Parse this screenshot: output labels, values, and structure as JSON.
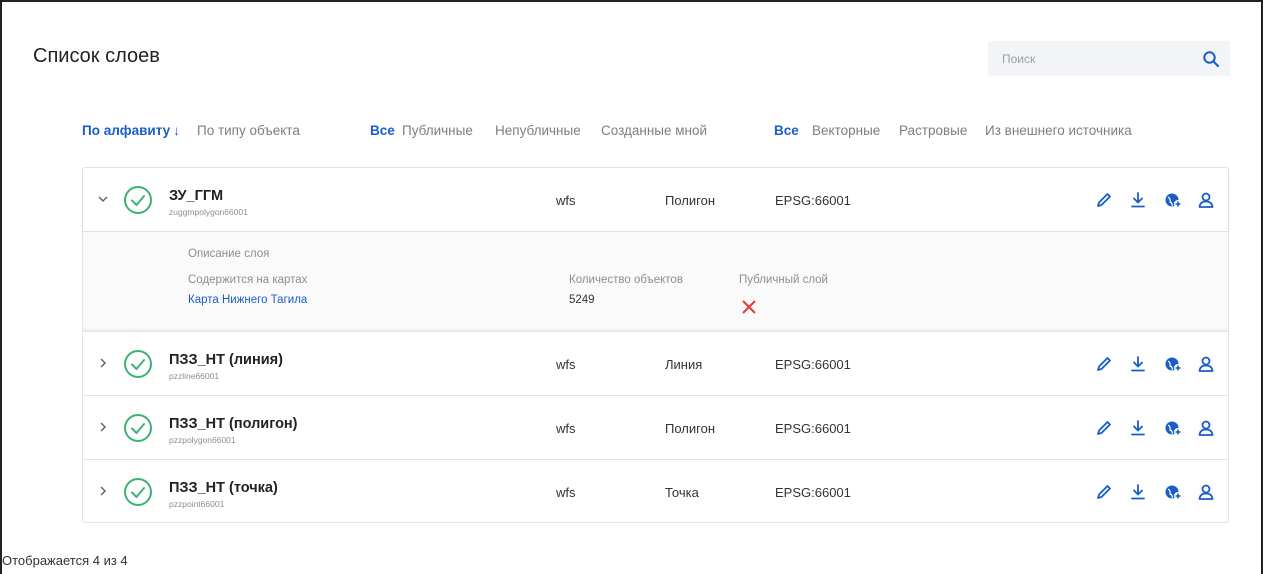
{
  "page": {
    "title": "Список слоев"
  },
  "search": {
    "placeholder": "Поиск"
  },
  "sort": {
    "alphabet": "По алфавиту",
    "by_type": "По типу объекта"
  },
  "visibility_filter": {
    "all": "Все",
    "public": "Публичные",
    "nonpublic": "Непубличные",
    "mine": "Созданные мной"
  },
  "kind_filter": {
    "all": "Все",
    "vector": "Векторные",
    "raster": "Растровые",
    "external": "Из внешнего источника"
  },
  "layers": [
    {
      "name": "ЗУ_ГГМ",
      "id": "zuggmpolygon66001",
      "service": "wfs",
      "geometry": "Полигон",
      "crs": "EPSG:66001",
      "expanded": true
    },
    {
      "name": "ПЗЗ_НТ (линия)",
      "id": "pzzline66001",
      "service": "wfs",
      "geometry": "Линия",
      "crs": "EPSG:66001",
      "expanded": false
    },
    {
      "name": "ПЗЗ_НТ (полигон)",
      "id": "pzzpolygon66001",
      "service": "wfs",
      "geometry": "Полигон",
      "crs": "EPSG:66001",
      "expanded": false
    },
    {
      "name": "ПЗЗ_НТ (точка)",
      "id": "pzzpoint66001",
      "service": "wfs",
      "geometry": "Точка",
      "crs": "EPSG:66001",
      "expanded": false
    }
  ],
  "details": {
    "description_label": "Описание слоя",
    "maps_label": "Содержится на картах",
    "map_link": "Карта Нижнего Тагила",
    "count_label": "Количество объектов",
    "count_value": "5249",
    "public_label": "Публичный слой",
    "public_value": false
  },
  "footer": {
    "text": "Отображается 4 из 4"
  },
  "colors": {
    "accent": "#1a5dc9",
    "status_ok": "#3cb371",
    "error": "#e53935"
  }
}
